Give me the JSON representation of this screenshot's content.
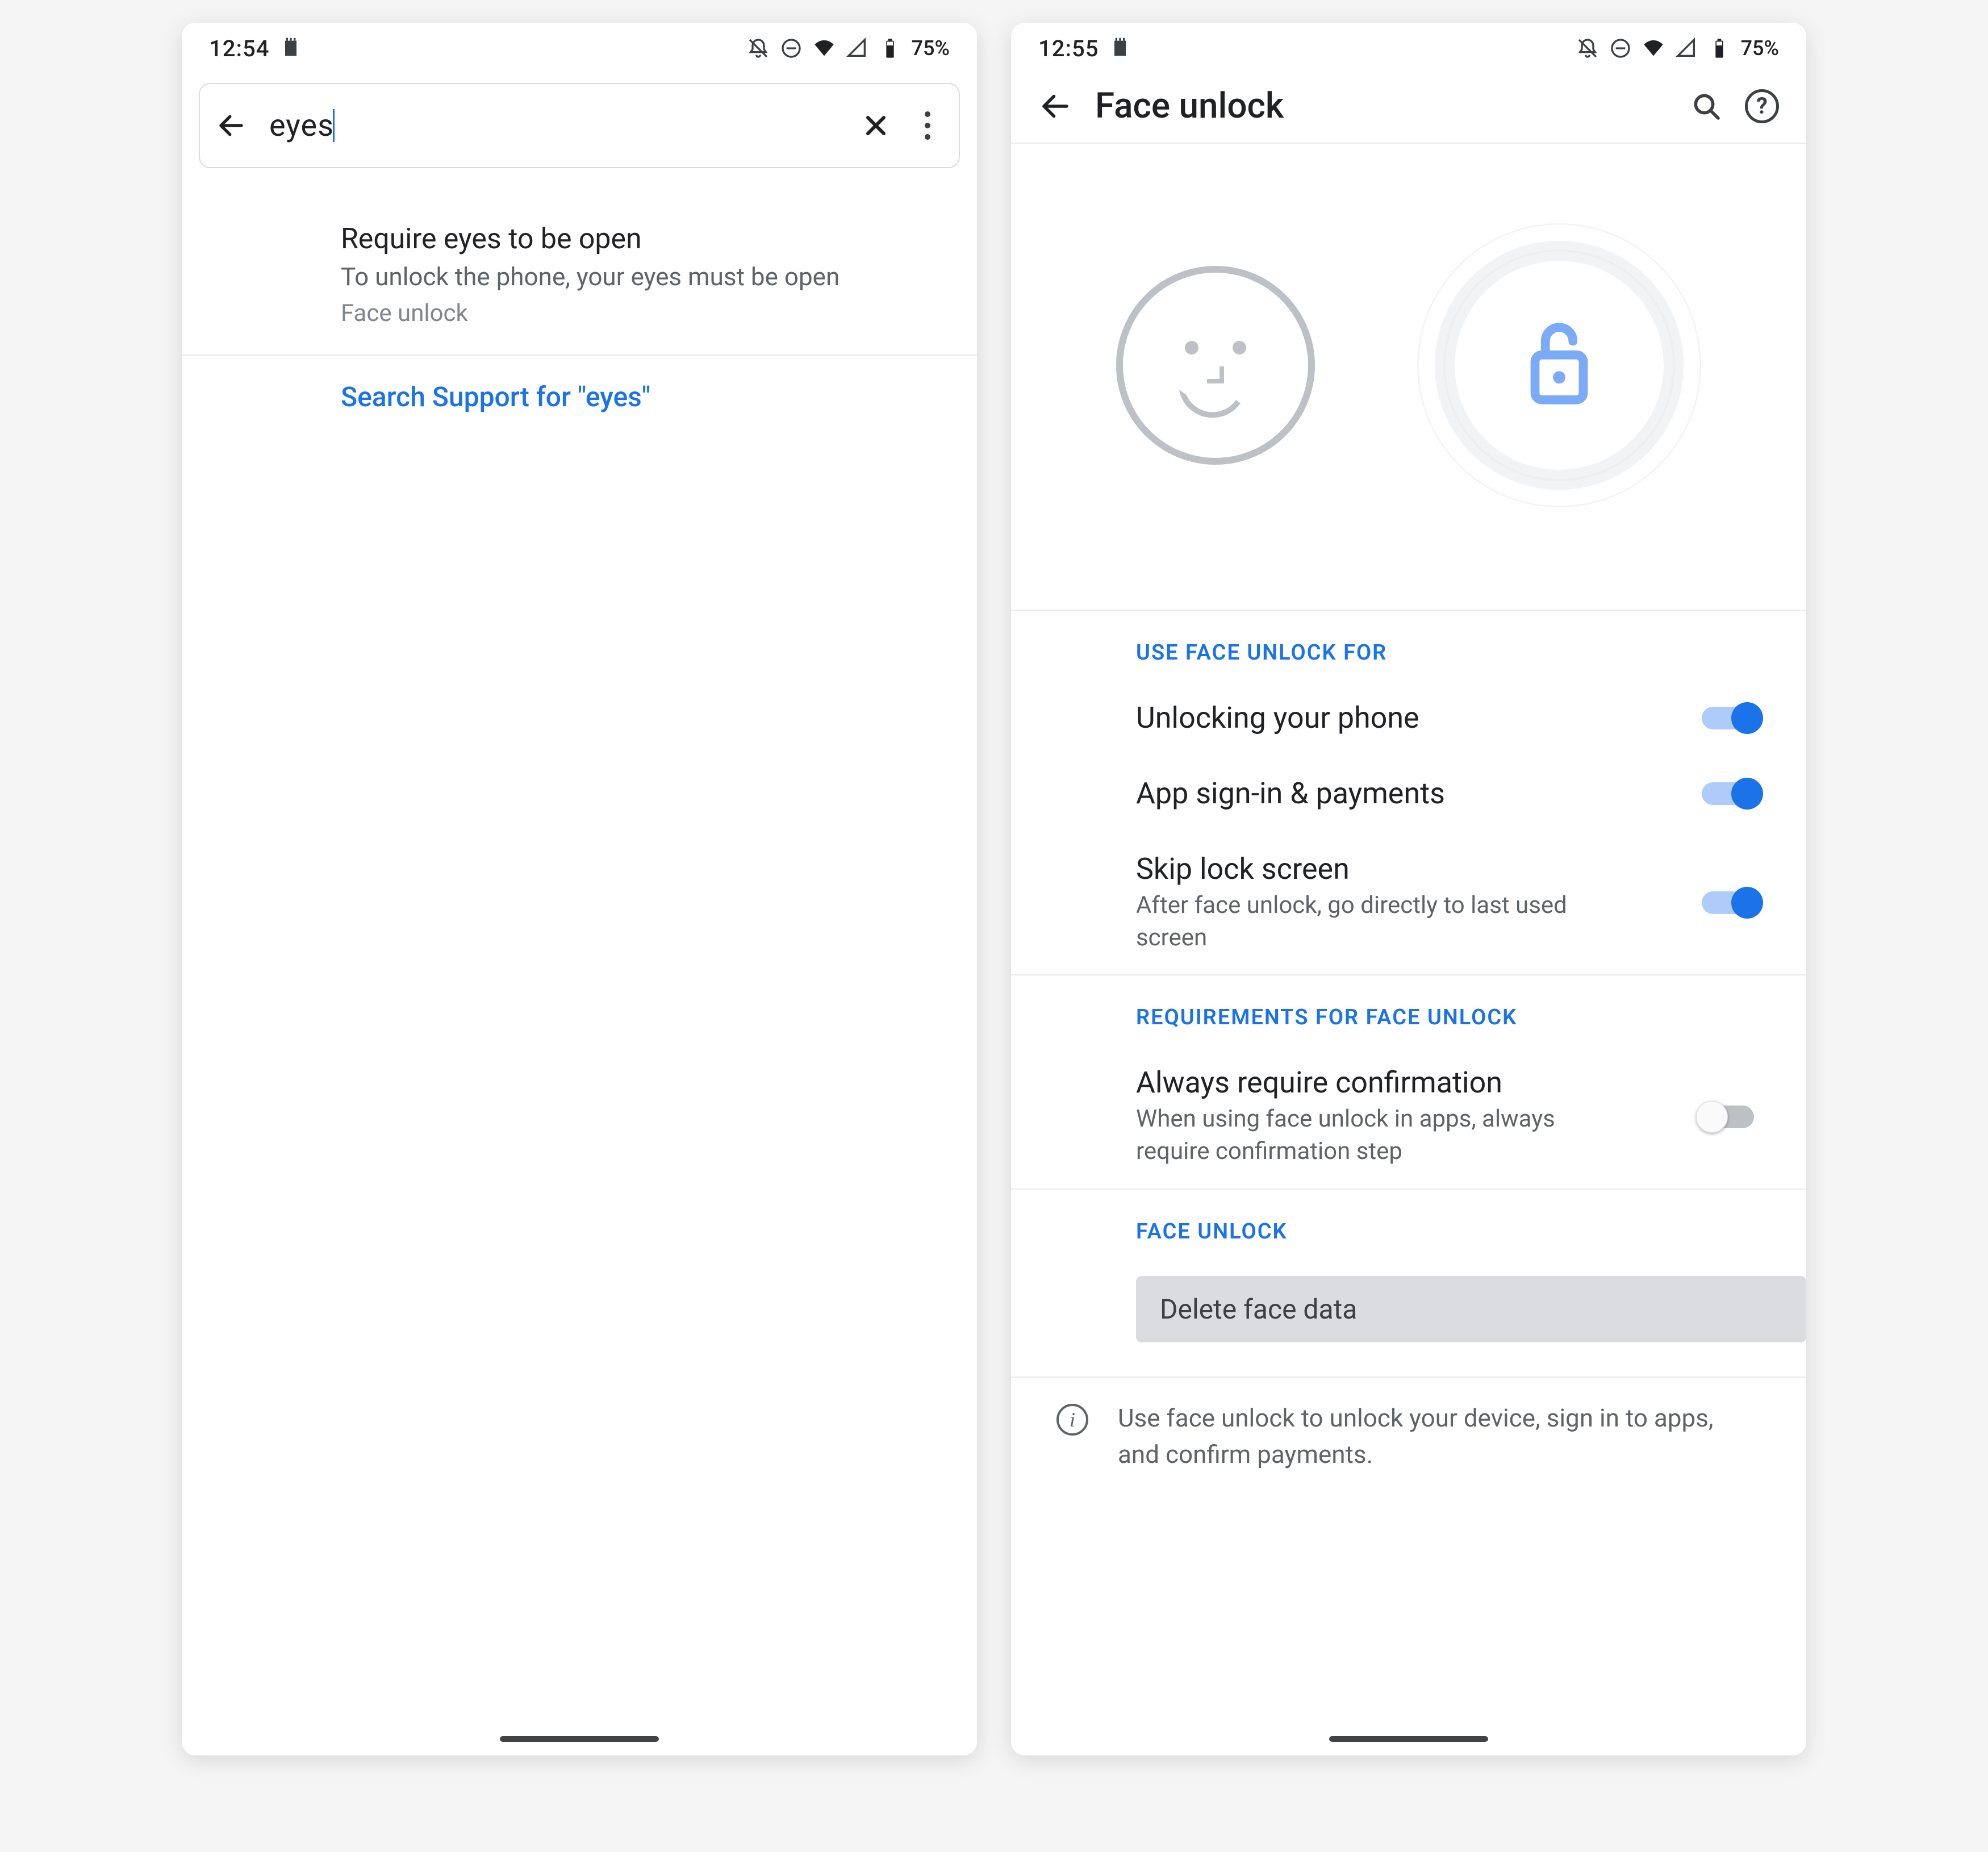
{
  "a": {
    "status": {
      "time": "12:54",
      "battery": "75%"
    },
    "search": {
      "value": "eyes",
      "result": {
        "title": "Require eyes to be open",
        "subtitle": "To unlock the phone, your eyes must be open",
        "category": "Face unlock"
      },
      "support_link": "Search Support for \"eyes\""
    }
  },
  "b": {
    "status": {
      "time": "12:55",
      "battery": "75%"
    },
    "title": "Face unlock",
    "sections": {
      "use_for": {
        "heading": "USE FACE UNLOCK FOR",
        "unlocking": {
          "label": "Unlocking your phone",
          "on": true
        },
        "appsignin": {
          "label": "App sign-in & payments",
          "on": true
        },
        "skiplock": {
          "label": "Skip lock screen",
          "desc": "After face unlock, go directly to last used screen",
          "on": true
        }
      },
      "reqs": {
        "heading": "REQUIREMENTS FOR FACE UNLOCK",
        "confirm": {
          "label": "Always require confirmation",
          "desc": "When using face unlock in apps, always require confirmation step",
          "on": false
        }
      },
      "faceunlock": {
        "heading": "FACE UNLOCK",
        "delete_label": "Delete face data"
      }
    },
    "footer": "Use face unlock to unlock your device, sign in to apps, and confirm payments."
  }
}
